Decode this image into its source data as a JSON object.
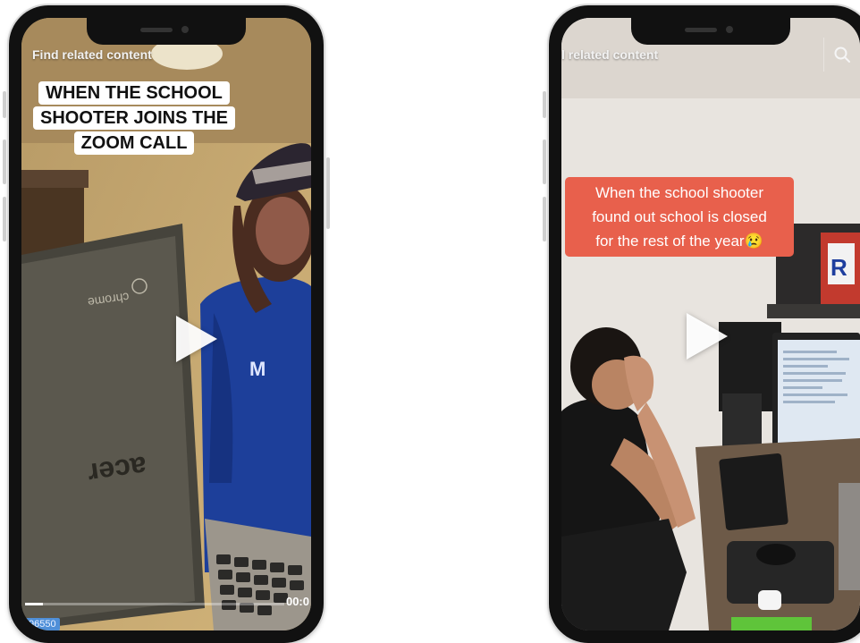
{
  "left_phone": {
    "find_related": "Find related content",
    "caption_lines": [
      "WHEN THE SCHOOL",
      "SHOOTER JOINS THE",
      "ZOOM CALL"
    ],
    "laptop_brand_top": "chrome",
    "laptop_brand_logo": "acer",
    "time": "00:0",
    "tag_text": "96550",
    "progress_fraction": 0.07
  },
  "right_phone": {
    "find_related": "l related content",
    "caption_lines": [
      "When the school shooter",
      "found out school is closed",
      "for the rest of the year😢"
    ],
    "poster_letter": "R",
    "search_icon": "search-icon"
  }
}
